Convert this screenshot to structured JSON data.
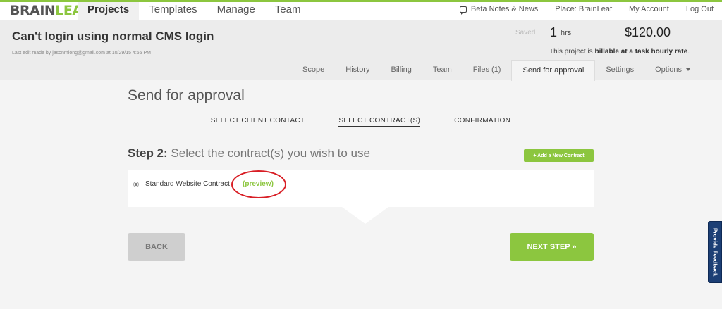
{
  "brand": {
    "logo_part1": "BRAIN",
    "logo_part2": "LEAF",
    "accent": "#8cc63f"
  },
  "nav": {
    "items": [
      {
        "label": "Projects",
        "active": true
      },
      {
        "label": "Templates"
      },
      {
        "label": "Manage"
      },
      {
        "label": "Team"
      }
    ],
    "right": {
      "beta_notes": "Beta Notes & News",
      "place": "Place: BrainLeaf",
      "account": "My Account",
      "logout": "Log Out"
    }
  },
  "project": {
    "title": "Can't login using normal CMS login",
    "last_edit": "Last edit made by jasonmiong@gmail.com at 10/29/15 4:55 PM",
    "saved": "Saved",
    "hours_value": "1",
    "hours_unit": "hrs",
    "price": "$120.00",
    "billable_prefix": "This project is",
    "billable_bold": "billable at a task hourly rate",
    "billable_suffix": "."
  },
  "tabs": [
    {
      "label": "Scope"
    },
    {
      "label": "History"
    },
    {
      "label": "Billing"
    },
    {
      "label": "Team"
    },
    {
      "label": "Files (1)"
    },
    {
      "label": "Send for approval",
      "active": true
    },
    {
      "label": "Settings"
    },
    {
      "label": "Options"
    }
  ],
  "main": {
    "heading": "Send for approval",
    "steps": [
      {
        "label": "SELECT CLIENT CONTACT"
      },
      {
        "label": "SELECT CONTRACT(S)",
        "active": true
      },
      {
        "label": "CONFIRMATION"
      }
    ],
    "step_prefix": "Step 2:",
    "step_text": "Select the contract(s) you wish to use",
    "add_button": "+ Add a New Contract",
    "contract_name": "Standard Website Contract",
    "preview_label": "(preview)",
    "back_label": "BACK",
    "next_label": "NEXT STEP »"
  },
  "feedback": {
    "label": "Provide Feedback",
    "color": "#1c3f75"
  },
  "annotation_color": "#d81e25"
}
